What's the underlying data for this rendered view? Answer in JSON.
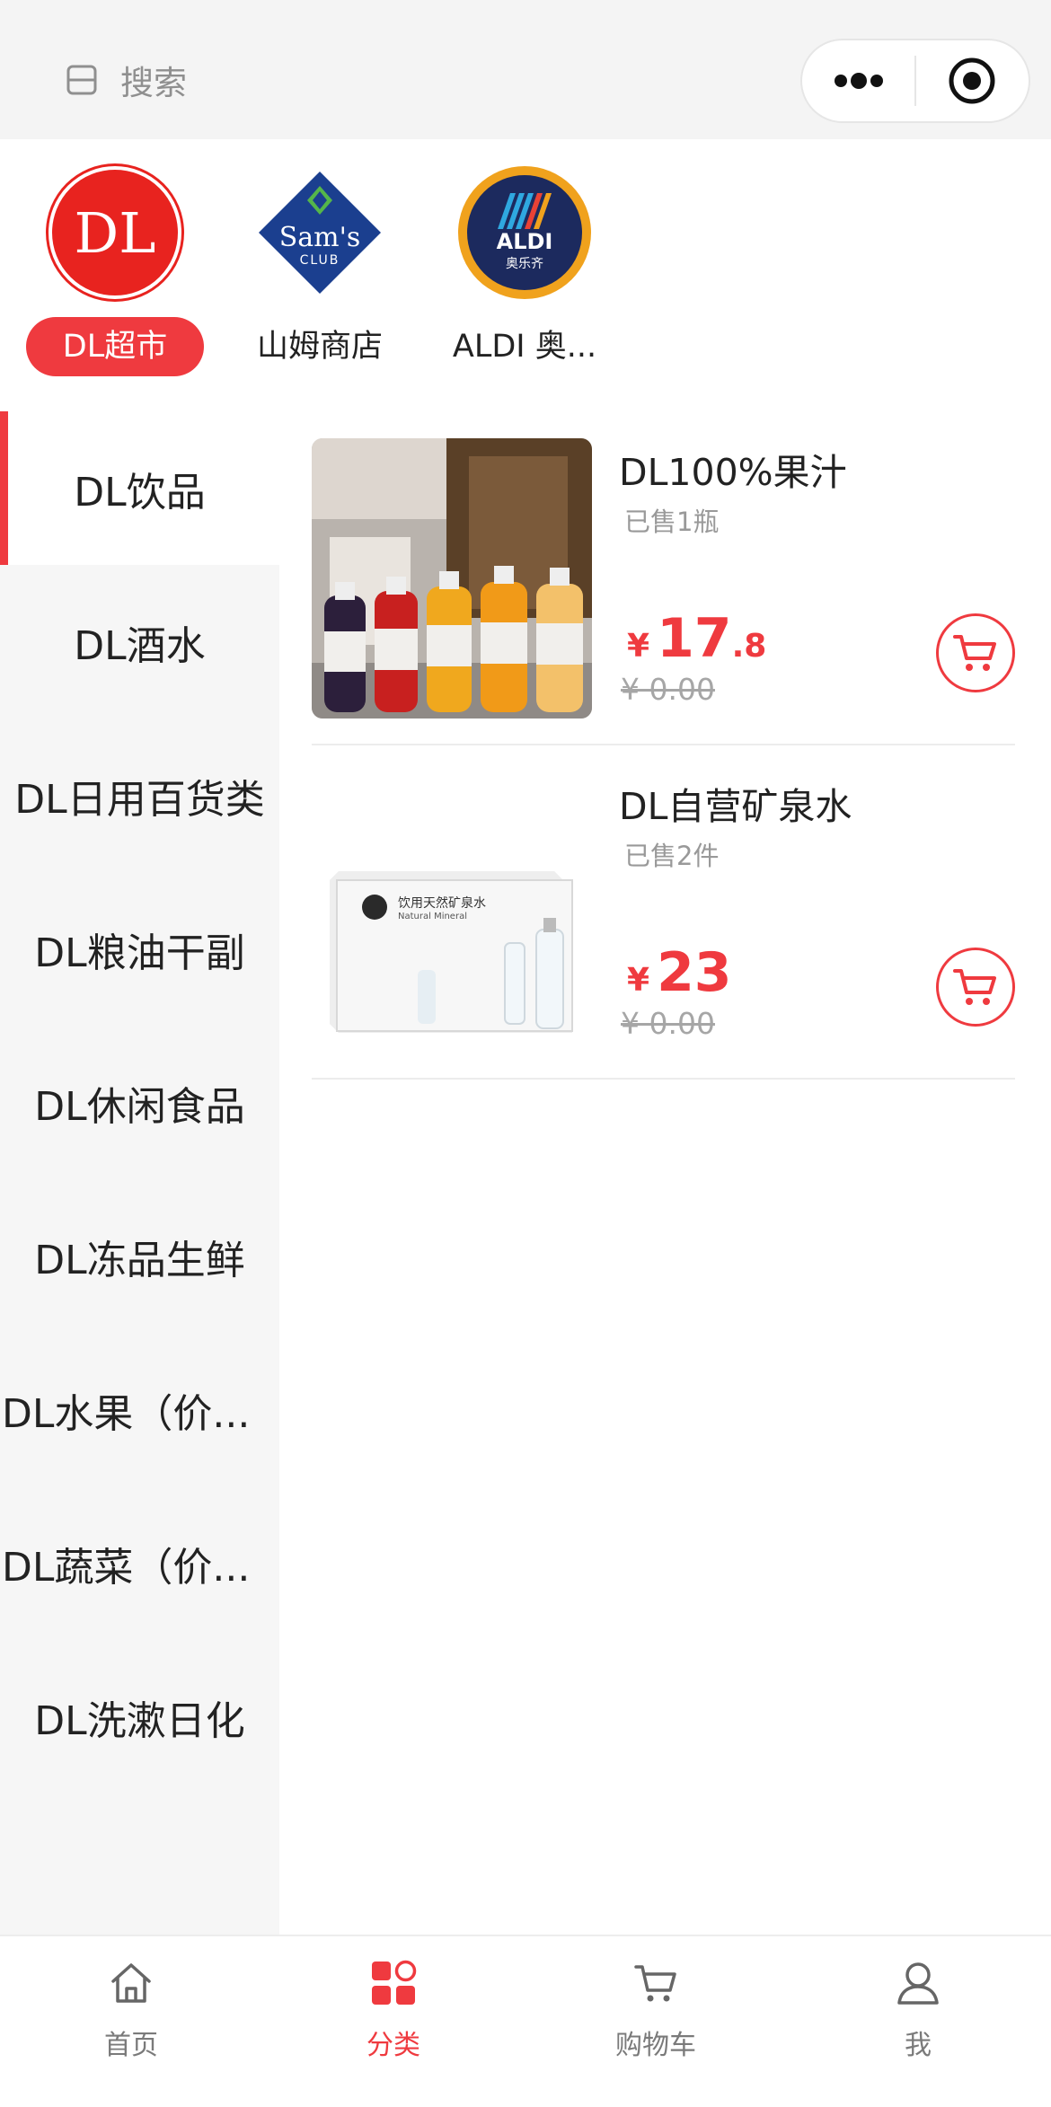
{
  "search": {
    "placeholder": "搜索"
  },
  "colors": {
    "accent": "#ef3a3f",
    "sidebar_bg": "#f6f6f6",
    "muted": "#999999"
  },
  "stores": [
    {
      "label": "DL超市",
      "logo_text": "DL",
      "active": true
    },
    {
      "label": "山姆商店",
      "logo_text": "Sam's",
      "logo_sub": "CLUB",
      "active": false
    },
    {
      "label": "ALDI 奥...",
      "logo_text": "ALDI",
      "logo_sub": "奥乐齐",
      "active": false
    }
  ],
  "sidebar": {
    "items": [
      {
        "label": "DL饮品",
        "active": true
      },
      {
        "label": "DL酒水"
      },
      {
        "label": "DL日用百货类"
      },
      {
        "label": "DL粮油干副"
      },
      {
        "label": "DL休闲食品"
      },
      {
        "label": "DL冻品生鲜"
      },
      {
        "label": "DL水果（价..."
      },
      {
        "label": "DL蔬菜（价..."
      },
      {
        "label": "DL洗漱日化"
      }
    ]
  },
  "products": [
    {
      "name": "DL100%果汁",
      "sold": "已售1瓶",
      "currency": "¥",
      "price_int": "17",
      "price_dec": ".8",
      "original": "¥ 0.00",
      "image": "juice-bottles"
    },
    {
      "name": "DL自营矿泉水",
      "sold": "已售2件",
      "currency": "¥",
      "price_int": "23",
      "price_dec": "",
      "original": "¥ 0.00",
      "image": "mineral-water-box",
      "box_text": "饮用天然矿泉水",
      "box_sub": "Natural Mineral"
    }
  ],
  "tabbar": {
    "items": [
      {
        "label": "首页",
        "icon": "home-icon",
        "active": false
      },
      {
        "label": "分类",
        "icon": "category-icon",
        "active": true
      },
      {
        "label": "购物车",
        "icon": "cart-icon",
        "active": false
      },
      {
        "label": "我",
        "icon": "user-icon",
        "active": false
      }
    ]
  }
}
